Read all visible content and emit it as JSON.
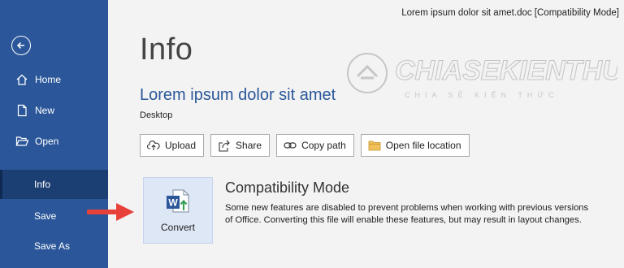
{
  "window": {
    "title": "Lorem ipsum dolor sit amet.doc [Compatibility Mode]"
  },
  "sidebar": {
    "back_icon": "back-arrow-icon",
    "items": [
      {
        "label": "Home",
        "icon": "home-icon",
        "active": false
      },
      {
        "label": "New",
        "icon": "new-document-icon",
        "active": false
      },
      {
        "label": "Open",
        "icon": "folder-open-icon",
        "active": false
      },
      {
        "label": "Info",
        "icon": "",
        "active": true
      },
      {
        "label": "Save",
        "icon": "",
        "active": false
      },
      {
        "label": "Save As",
        "icon": "",
        "active": false
      }
    ]
  },
  "main": {
    "page_title": "Info",
    "document_title": "Lorem ipsum dolor sit amet",
    "document_location": "Desktop",
    "actions": [
      {
        "label": "Upload",
        "icon": "cloud-upload-icon"
      },
      {
        "label": "Share",
        "icon": "share-icon"
      },
      {
        "label": "Copy path",
        "icon": "link-icon"
      },
      {
        "label": "Open file location",
        "icon": "folder-icon"
      }
    ],
    "compatibility": {
      "button_label": "Convert",
      "heading": "Compatibility Mode",
      "description": "Some new features are disabled to prevent problems when working with previous versions of Office. Converting this file will enable these features, but may result in layout changes."
    }
  },
  "watermark": {
    "brand": "CHIASEKIENTHUC",
    "tagline": "CHIA SẺ KIẾN THỨC"
  },
  "colors": {
    "sidebar": "#2b579a",
    "sidebar_active": "#1c3f73",
    "accent": "#2b579a",
    "annotation_arrow": "#e8413a"
  }
}
